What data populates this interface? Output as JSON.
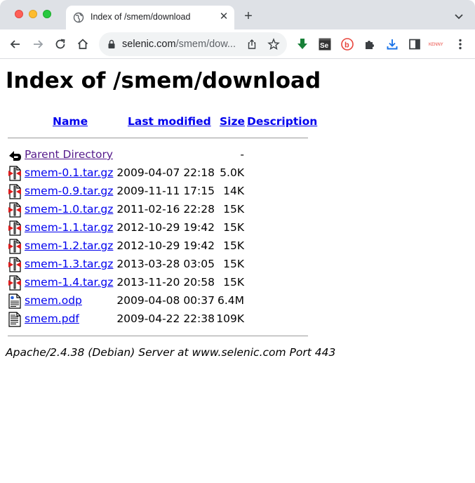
{
  "browser": {
    "tab_title": "Index of /smem/download",
    "url_host": "selenic.com",
    "url_rest": "/smem/dow...",
    "extensions": [
      "download-arrow-icon",
      "selenium-icon",
      "bing-icon",
      "puzzle-icon",
      "downloads-icon",
      "sidepanel-icon",
      "kenny-icon",
      "menu-icon"
    ],
    "ext_kenny_label": "KENNY"
  },
  "page": {
    "title": "Index of /smem/download",
    "columns": {
      "name": "Name",
      "last_modified": "Last modified",
      "size": "Size",
      "description": "Description"
    },
    "rows": [
      {
        "name": "Parent Directory",
        "date": "",
        "size": "-",
        "icon": "back-icon"
      },
      {
        "name": "smem-0.1.tar.gz",
        "date": "2009-04-07 22:18",
        "size": "5.0K",
        "icon": "compressed-icon"
      },
      {
        "name": "smem-0.9.tar.gz",
        "date": "2009-11-11 17:15",
        "size": "14K",
        "icon": "compressed-icon"
      },
      {
        "name": "smem-1.0.tar.gz",
        "date": "2011-02-16 22:28",
        "size": "15K",
        "icon": "compressed-icon"
      },
      {
        "name": "smem-1.1.tar.gz",
        "date": "2012-10-29 19:42",
        "size": "15K",
        "icon": "compressed-icon"
      },
      {
        "name": "smem-1.2.tar.gz",
        "date": "2012-10-29 19:42",
        "size": "15K",
        "icon": "compressed-icon"
      },
      {
        "name": "smem-1.3.tar.gz",
        "date": "2013-03-28 03:05",
        "size": "15K",
        "icon": "compressed-icon"
      },
      {
        "name": "smem-1.4.tar.gz",
        "date": "2013-11-20 20:58",
        "size": "15K",
        "icon": "compressed-icon"
      },
      {
        "name": "smem.odp",
        "date": "2009-04-08 00:37",
        "size": "6.4M",
        "icon": "layout-icon"
      },
      {
        "name": "smem.pdf",
        "date": "2009-04-22 22:38",
        "size": "109K",
        "icon": "text-file-icon"
      }
    ],
    "footer": "Apache/2.4.38 (Debian) Server at www.selenic.com Port 443"
  }
}
